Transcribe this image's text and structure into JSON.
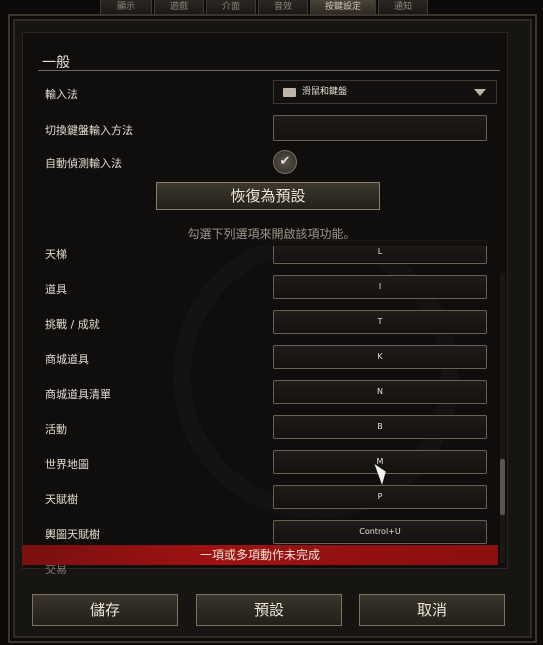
{
  "tabs": [
    "顯示",
    "遊戲",
    "介面",
    "音效",
    "按鍵設定",
    "通知"
  ],
  "active_tab": "按鍵設定",
  "general": {
    "title": "一般",
    "input_method_label": "輸入法",
    "input_method_value": "滑鼠和鍵盤",
    "switch_keyboard_label": "切換鍵盤輸入方法",
    "switch_keyboard_value": "",
    "auto_detect_label": "自動偵測輸入法",
    "auto_detect_checked": true
  },
  "reset_button": "恢復為預設",
  "hint": "勾選下列選項來開啟該項功能。",
  "keybinds": [
    {
      "label": "天梯",
      "key": "L"
    },
    {
      "label": "道具",
      "key": "I"
    },
    {
      "label": "挑戰 / 成就",
      "key": "T"
    },
    {
      "label": "商城道具",
      "key": "K"
    },
    {
      "label": "商城道具清單",
      "key": "N"
    },
    {
      "label": "活動",
      "key": "B"
    },
    {
      "label": "世界地圖",
      "key": "M"
    },
    {
      "label": "天賦樹",
      "key": "P"
    },
    {
      "label": "輿圖天賦樹",
      "key": "Control+U"
    },
    {
      "label": "交易",
      "key": ""
    }
  ],
  "error_text": "一項或多項動作未完成",
  "footer": {
    "save": "儲存",
    "default": "預設",
    "cancel": "取消"
  }
}
